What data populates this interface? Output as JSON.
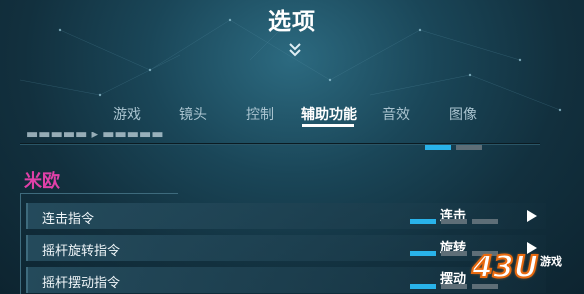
{
  "header": {
    "title": "选项"
  },
  "tabs": [
    {
      "label": "游戏",
      "active": false
    },
    {
      "label": "镜头",
      "active": false
    },
    {
      "label": "控制",
      "active": false
    },
    {
      "label": "辅助功能",
      "active": true
    },
    {
      "label": "音效",
      "active": false
    },
    {
      "label": "图像",
      "active": false
    }
  ],
  "section": {
    "title": "米欧"
  },
  "settings": [
    {
      "label": "连击指令",
      "value": "连击"
    },
    {
      "label": "摇杆旋转指令",
      "value": "旋转"
    },
    {
      "label": "摇杆摆动指令",
      "value": "摆动"
    }
  ],
  "watermark": {
    "main": "43U",
    "sub": "游戏"
  },
  "colors": {
    "accent": "#29b3ea",
    "section": "#e040a8",
    "inactive_segment": "#5e6e77"
  },
  "icons": {
    "collapse": "double-chevron-down-icon",
    "next": "play-arrow-icon"
  }
}
